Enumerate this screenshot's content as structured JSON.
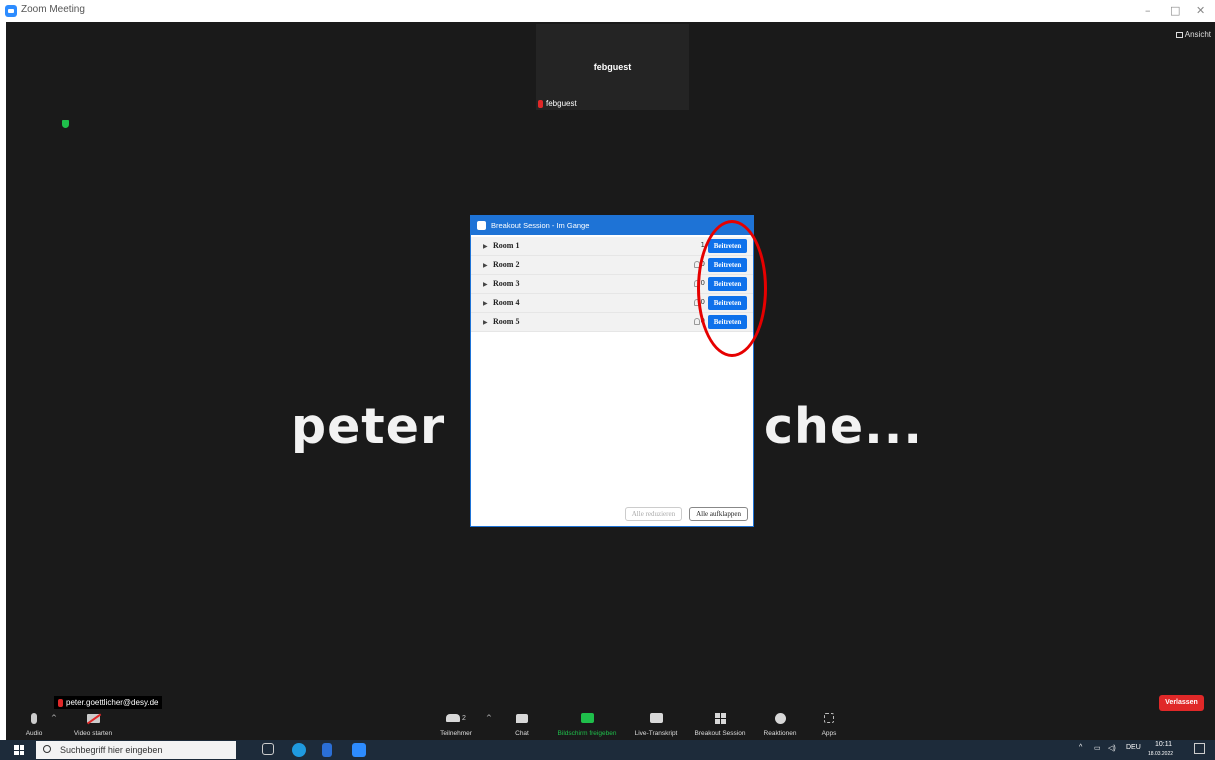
{
  "window": {
    "title": "Zoom Meeting",
    "minimize": "–",
    "maximize": "□",
    "close": "✕"
  },
  "meeting": {
    "view_button": "Ansicht",
    "thumbnail_name": "febguest",
    "thumbnail_label": "febguest",
    "speaker_name_left": "peter",
    "speaker_name_right": "che...",
    "self_label": "peter.goettlicher@desy.de"
  },
  "breakout": {
    "title": "Breakout Session - Im Gange",
    "rooms": [
      {
        "name": "Room 1",
        "count": "1",
        "join": "Beitreten"
      },
      {
        "name": "Room 2",
        "count": "0",
        "join": "Beitreten"
      },
      {
        "name": "Room 3",
        "count": "0",
        "join": "Beitreten"
      },
      {
        "name": "Room 4",
        "count": "0",
        "join": "Beitreten"
      },
      {
        "name": "Room 5",
        "count": "0",
        "join": "Beitreten"
      }
    ],
    "collapse_all": "Alle reduzieren",
    "expand_all": "Alle aufklappen"
  },
  "toolbar": {
    "audio": "Audio",
    "video": "Video starten",
    "participants": "Teilnehmer",
    "participants_count": "2",
    "chat": "Chat",
    "share": "Bildschirm freigeben",
    "transcript": "Live-Transkript",
    "breakout": "Breakout Session",
    "reactions": "Reaktionen",
    "apps": "Apps",
    "leave": "Verlassen",
    "share_color": "#1fbf4b"
  },
  "taskbar": {
    "search_placeholder": "Suchbegriff hier eingeben",
    "language": "DEU",
    "time": "10:11",
    "date": "18.03.2022"
  },
  "colors": {
    "accent": "#0e71eb",
    "leave": "#e02828",
    "highlight_circle": "#e60000"
  }
}
